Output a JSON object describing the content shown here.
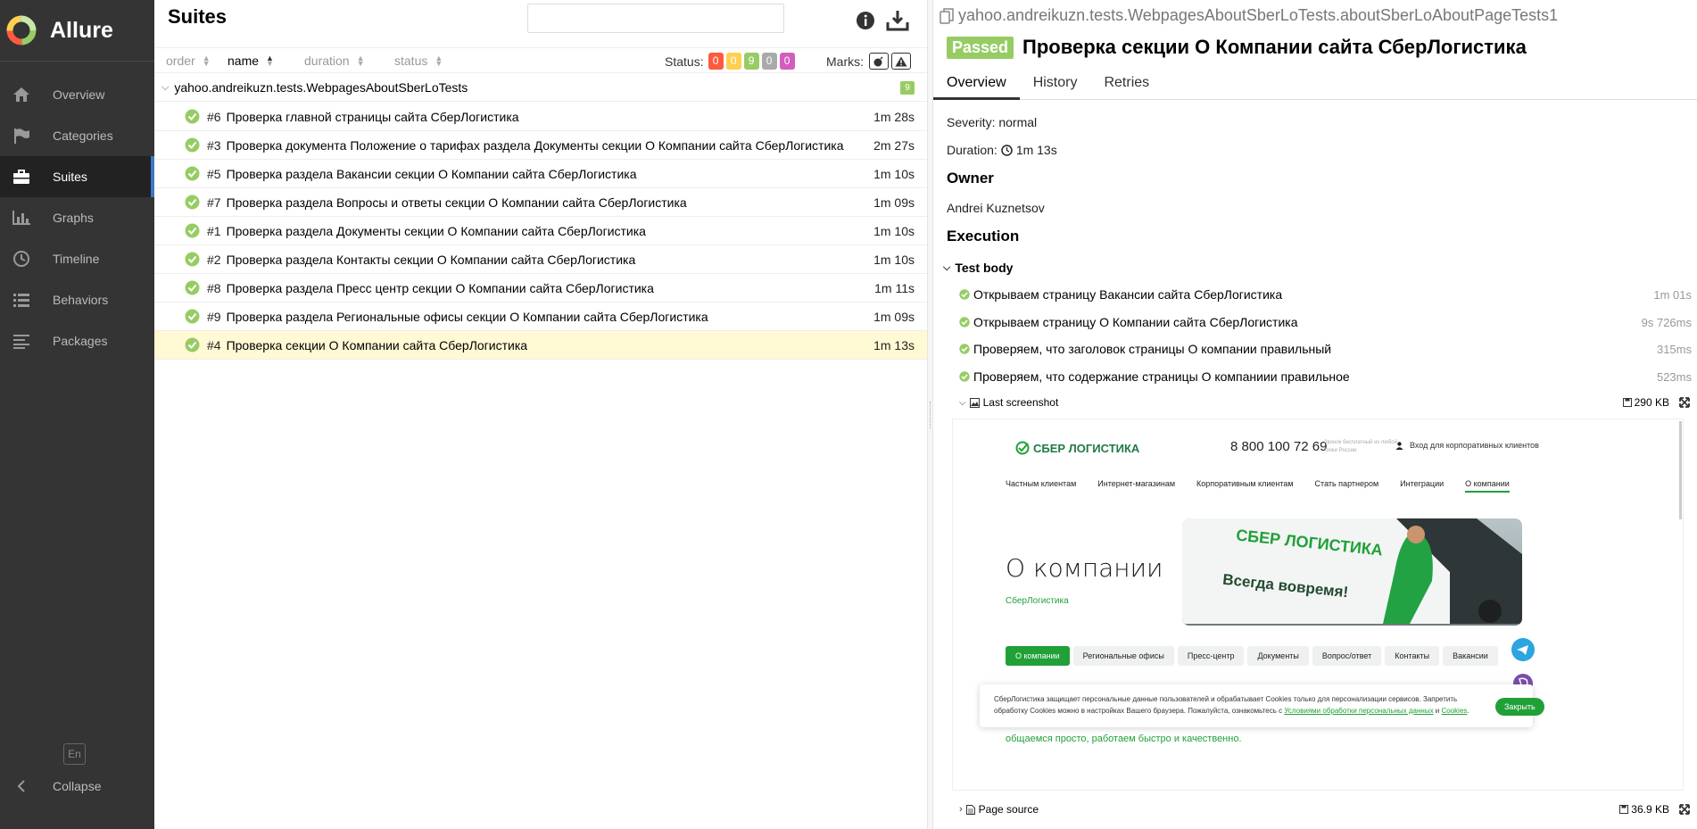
{
  "sidebar": {
    "brand": "Allure",
    "items": [
      {
        "label": "Overview",
        "icon": "home-icon"
      },
      {
        "label": "Categories",
        "icon": "flag-icon"
      },
      {
        "label": "Suites",
        "icon": "briefcase-icon",
        "active": true
      },
      {
        "label": "Graphs",
        "icon": "bar-chart-icon"
      },
      {
        "label": "Timeline",
        "icon": "clock-icon"
      },
      {
        "label": "Behaviors",
        "icon": "list-icon"
      },
      {
        "label": "Packages",
        "icon": "align-left-icon"
      }
    ],
    "language": "En",
    "collapse_label": "Collapse"
  },
  "suites": {
    "title": "Suites",
    "search_value": "",
    "sort": {
      "order": "order",
      "name": "name",
      "duration": "duration",
      "status": "status"
    },
    "status_label": "Status:",
    "status_counts": [
      {
        "value": "0",
        "color": "#fd5a3e"
      },
      {
        "value": "0",
        "color": "#ffd050"
      },
      {
        "value": "9",
        "color": "#97cc64"
      },
      {
        "value": "0",
        "color": "#aaaaaa"
      },
      {
        "value": "0",
        "color": "#d35ebe"
      }
    ],
    "marks_label": "Marks:",
    "group": {
      "name": "yahoo.andreikuzn.tests.WebpagesAboutSberLoTests",
      "count": "9"
    },
    "rows": [
      {
        "num": "#6",
        "name": "Проверка главной страницы сайта СберЛогистика",
        "duration": "1m 28s"
      },
      {
        "num": "#3",
        "name": "Проверка документа Положение о тарифах раздела Документы секции О Компании сайта СберЛогистика",
        "duration": "2m 27s"
      },
      {
        "num": "#5",
        "name": "Проверка раздела Вакансии секции О Компании сайта СберЛогистика",
        "duration": "1m 10s"
      },
      {
        "num": "#7",
        "name": "Проверка раздела Вопросы и ответы секции О Компании сайта СберЛогистика",
        "duration": "1m 09s"
      },
      {
        "num": "#1",
        "name": "Проверка раздела Документы секции О Компании сайта СберЛогистика",
        "duration": "1m 10s"
      },
      {
        "num": "#2",
        "name": "Проверка раздела Контакты секции О Компании сайта СберЛогистика",
        "duration": "1m 10s"
      },
      {
        "num": "#8",
        "name": "Проверка раздела Пресс центр секции О Компании сайта СберЛогистика",
        "duration": "1m 11s"
      },
      {
        "num": "#9",
        "name": "Проверка раздела Региональные офисы секции О Компании сайта СберЛогистика",
        "duration": "1m 09s"
      },
      {
        "num": "#4",
        "name": "Проверка секции О Компании сайта СберЛогистика",
        "duration": "1m 13s",
        "selected": true
      }
    ]
  },
  "detail": {
    "breadcrumb": "yahoo.andreikuzn.tests.WebpagesAboutSberLoTests.aboutSberLoAboutPageTests1",
    "status": "Passed",
    "title": "Проверка секции О Компании сайта СберЛогистика",
    "tabs": [
      "Overview",
      "History",
      "Retries"
    ],
    "severity": "Severity: normal",
    "duration_label": "Duration:",
    "duration_value": "1m 13s",
    "owner_heading": "Owner",
    "owner": "Andrei Kuznetsov",
    "execution_heading": "Execution",
    "test_body": "Test body",
    "steps": [
      {
        "name": "Открываем страницу Вакансии сайта СберЛогистика",
        "duration": "1m 01s"
      },
      {
        "name": "Открываем страницу О Компании сайта СберЛогистика",
        "duration": "9s 726ms"
      },
      {
        "name": "Проверяем, что заголовок страницы О компании правильный",
        "duration": "315ms"
      },
      {
        "name": "Проверяем, что содержание страницы О компаниии правильное",
        "duration": "523ms"
      }
    ],
    "attachments": [
      {
        "name": "Last screenshot",
        "size": "290 KB"
      },
      {
        "name": "Page source",
        "size": "36.9 KB"
      }
    ]
  },
  "screenshot": {
    "logo": "СБЕР ЛОГИСТИКА",
    "phone": "8 800 100 72 69",
    "free_call": "Звонок бесплатный из любой точки России",
    "login": "Вход для корпоративных клиентов",
    "nav": [
      "Частным клиентам",
      "Интернет-магазинам",
      "Корпоративным клиентам",
      "Стать партнером",
      "Интеграции",
      "О компании"
    ],
    "heading": "О компании",
    "subheading": "СберЛогистика",
    "hero_brand": "СБЕР ЛОГИСТИКА",
    "hero_slogan": "Всегда вовремя!",
    "tabs": [
      "О компании",
      "Региональные офисы",
      "Пресс-центр",
      "Документы",
      "Вопрос/ответ",
      "Контакты",
      "Вакансии"
    ],
    "cookie_text_1": "СберЛогистика защищает персональные данные пользователей и обрабатывает Cookies только для персонализации сервисов. Запретить обработку Cookies можно в настройках Вашего браузера. Пожалуйста, ознакомьтесь с ",
    "cookie_link_1": "Условиями обработки персональных данных",
    "cookie_and": " и ",
    "cookie_link_2": "Cookies",
    "cookie_dot": ".",
    "cookie_close": "Закрыть",
    "tagline": "общаемся просто, работаем быстро и качественно."
  }
}
